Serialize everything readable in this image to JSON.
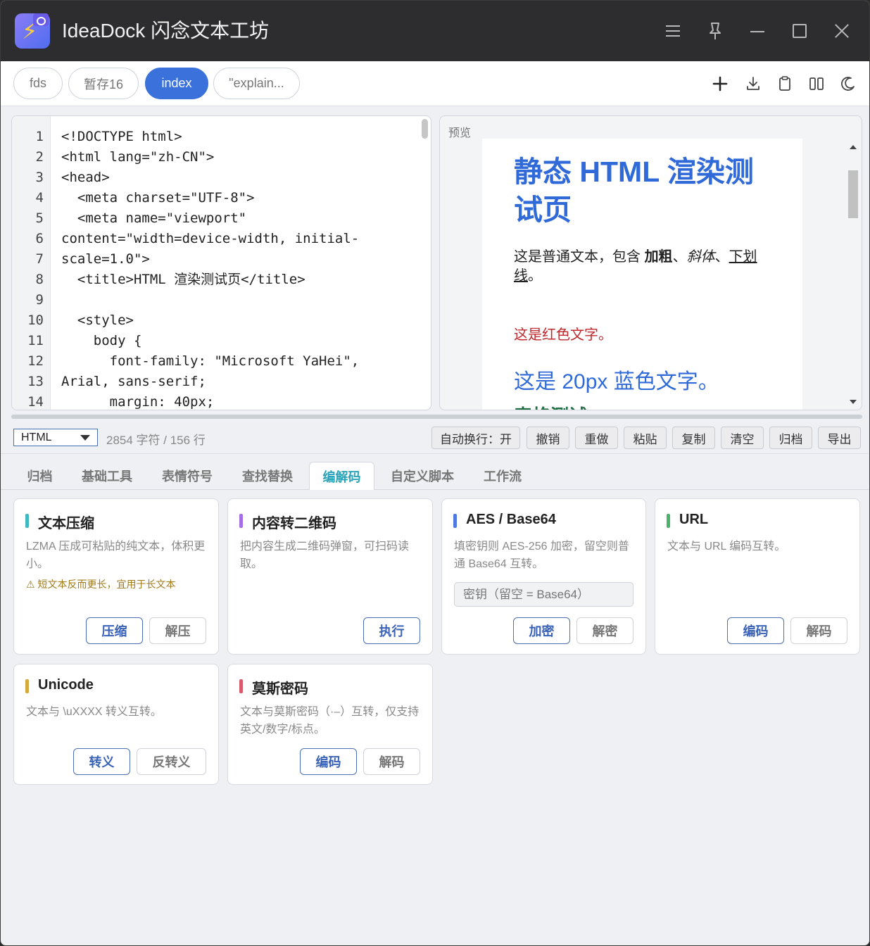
{
  "app": {
    "title": "IdeaDock 闪念文本工坊"
  },
  "tabs": [
    {
      "label": "fds",
      "active": false
    },
    {
      "label": "暂存16",
      "active": false
    },
    {
      "label": "index",
      "active": true
    },
    {
      "label": "\"explain...",
      "active": false
    }
  ],
  "toolbar_icons": [
    "plus-icon",
    "download-icon",
    "clipboard-icon",
    "split-view-icon",
    "moon-icon"
  ],
  "editor": {
    "line_numbers": [
      "1",
      "2",
      "3",
      "4",
      "5",
      "6",
      "7",
      "8",
      "9",
      "10",
      "11",
      "12",
      "13",
      "14"
    ],
    "lines": [
      "<!DOCTYPE html>",
      "<html lang=\"zh-CN\">",
      "<head>",
      "  <meta charset=\"UTF-8\">",
      "  <meta name=\"viewport\"",
      "content=\"width=device-width, initial-",
      "scale=1.0\">",
      "  <title>HTML 渲染测试页</title>",
      "",
      "  <style>",
      "    body {",
      "      font-family: \"Microsoft YaHei\",",
      "Arial, sans-serif;",
      "      margin: 40px;"
    ]
  },
  "preview": {
    "label": "预览",
    "h1_line1": "静态 HTML 渲染测",
    "h1_line2": "试页",
    "p1_start": "这是普通文本，包含 ",
    "p1_bold": "加粗",
    "p1_sep1": "、",
    "p1_italic": "斜体",
    "p1_sep2": "、",
    "p1_underline_1": "下划",
    "p1_underline_2": "线",
    "p1_end": "。",
    "red_text": "这是红色文字。",
    "blue_text": "这是 20px 蓝色文字。",
    "green_heading": "表格测试"
  },
  "statusbar": {
    "language": "HTML",
    "stats": "2854 字符 / 156 行",
    "buttons": [
      "自动换行：开",
      "撤销",
      "重做",
      "粘贴",
      "复制",
      "清空",
      "归档",
      "导出"
    ]
  },
  "tool_tabs": [
    {
      "label": "归档",
      "active": false
    },
    {
      "label": "基础工具",
      "active": false
    },
    {
      "label": "表情符号",
      "active": false
    },
    {
      "label": "查找替换",
      "active": false
    },
    {
      "label": "编解码",
      "active": true
    },
    {
      "label": "自定义脚本",
      "active": false
    },
    {
      "label": "工作流",
      "active": false
    }
  ],
  "cards": [
    {
      "title": "文本压缩",
      "color": "#3fb8c0",
      "desc": "LZMA 压成可粘贴的纯文本，体积更小。",
      "warning": "⚠ 短文本反而更长，宜用于长文本",
      "buttons": [
        "压缩",
        "解压"
      ]
    },
    {
      "title": "内容转二维码",
      "color": "#a56ee8",
      "desc": "把内容生成二维码弹窗，可扫码读取。",
      "buttons": [
        "执行"
      ]
    },
    {
      "title": "AES / Base64",
      "color": "#4f78e0",
      "desc": "填密钥则 AES-256 加密，留空则普通 Base64 互转。",
      "input_placeholder": "密钥（留空 = Base64）",
      "buttons": [
        "加密",
        "解密"
      ]
    },
    {
      "title": "URL",
      "color": "#4bb36e",
      "desc": "文本与 URL 编码互转。",
      "buttons": [
        "编码",
        "解码"
      ]
    },
    {
      "title": "Unicode",
      "color": "#d6a93d",
      "desc": "文本与 \\uXXXX 转义互转。",
      "buttons": [
        "转义",
        "反转义"
      ]
    },
    {
      "title": "莫斯密码",
      "color": "#d9596b",
      "desc": "文本与莫斯密码（·–）互转，仅支持英文/数字/标点。",
      "buttons": [
        "编码",
        "解码"
      ]
    }
  ]
}
